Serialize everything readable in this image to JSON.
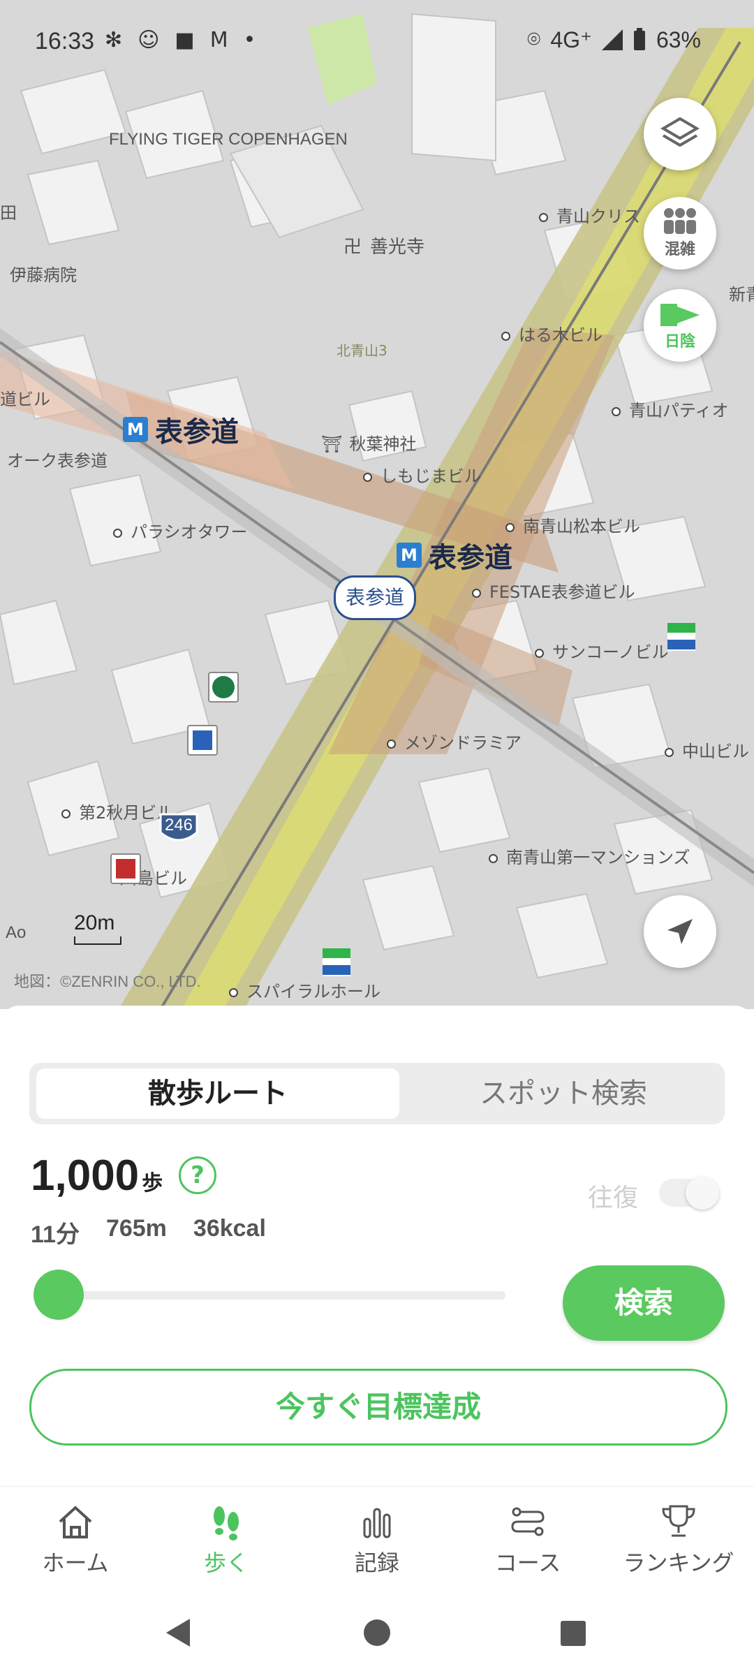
{
  "status": {
    "time": "16:33",
    "network": "4G⁺",
    "battery": "63%"
  },
  "map": {
    "labels": {
      "flying_tiger": "FLYING TIGER COPENHAGEN",
      "zenkoji": "善光寺",
      "kitaaoyama": "北青山3",
      "harukibiru": "はる木ビル",
      "aoyama_kuris": "青山クリス",
      "aoyama_paty": "青山パティオ",
      "itou": "伊藤病院",
      "akihajinja": "秋葉神社",
      "shimojima": "しもじまビル",
      "ok_omotesando": "オーク表参道",
      "paracio": "パラシオタワー",
      "minami_matsumoto": "南青山松本ビル",
      "festae": "FESTAE表参道ビル",
      "sanko": "サンコーノビル",
      "maison": "メゾンドラミア",
      "nakayama": "中山ビル",
      "daini_akizuki": "第2秋月ビル",
      "kawashima": "川島ビル",
      "minami_daiichi": "南青山第一マンションズ",
      "spiral": "スパイラルホール",
      "shinaoyama": "新青山",
      "mido": "道ビル",
      "ta": "田"
    },
    "station_big_1": "表参道",
    "station_big_2": "表参道",
    "station_pill": "表参道",
    "route_number": "246",
    "scale": "20m",
    "credit": "地図：©ZENRIN CO., LTD.",
    "ao": "Ao"
  },
  "fabs": {
    "crowd_label": "混雑",
    "shade_label": "日陰"
  },
  "sheet": {
    "tab_route": "散歩ルート",
    "tab_spot": "スポット検索",
    "steps_value": "1,000",
    "steps_unit": "歩",
    "help": "?",
    "round_trip": "往復",
    "duration": "11分",
    "distance": "765m",
    "calories": "36kcal",
    "slider_fraction": 0.0,
    "search_button": "検索",
    "goal_button": "今すぐ目標達成"
  },
  "tabs": [
    {
      "label": "ホーム",
      "icon": "home-icon"
    },
    {
      "label": "歩く",
      "icon": "footprints-icon"
    },
    {
      "label": "記録",
      "icon": "bar-chart-icon"
    },
    {
      "label": "コース",
      "icon": "route-icon"
    },
    {
      "label": "ランキング",
      "icon": "trophy-icon"
    }
  ],
  "colors": {
    "accent": "#5ac95f",
    "metro": "#2a7fd0"
  }
}
